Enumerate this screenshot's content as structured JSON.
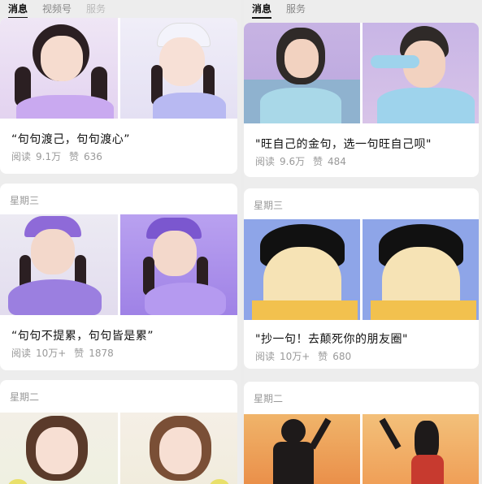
{
  "left_panel": {
    "tabs": [
      "消息",
      "视频号",
      "服务"
    ],
    "cards": [
      {
        "day": "",
        "title": "“句句渡己，句句渡心”",
        "read_label": "阅读",
        "reads": "9.1万",
        "like_label": "赞",
        "likes": "636"
      },
      {
        "day": "星期三",
        "title": "“句句不提累，句句皆是累”",
        "read_label": "阅读",
        "reads": "10万+",
        "like_label": "赞",
        "likes": "1878"
      },
      {
        "day": "星期二",
        "title": "",
        "read_label": "",
        "reads": "",
        "like_label": "",
        "likes": ""
      }
    ]
  },
  "right_panel": {
    "tabs": [
      "消息",
      "服务"
    ],
    "cards": [
      {
        "day": "",
        "title": "\"旺自己的金句，选一句旺自己呗\"",
        "read_label": "阅读",
        "reads": "9.6万",
        "like_label": "赞",
        "likes": "484"
      },
      {
        "day": "星期三",
        "title": "\"抄一句！去颠死你的朋友圈\"",
        "read_label": "阅读",
        "reads": "10万+",
        "like_label": "赞",
        "likes": "680"
      },
      {
        "day": "星期二",
        "title": "",
        "read_label": "",
        "reads": "",
        "like_label": "",
        "likes": ""
      }
    ]
  },
  "colors": {
    "lavender": "#cbbcf0",
    "purple_dress": "#9b7fe0",
    "blue_sky": "#8ea5e8",
    "pastel_sky": "#c9b8e6",
    "sunset": "#f2a35a"
  }
}
